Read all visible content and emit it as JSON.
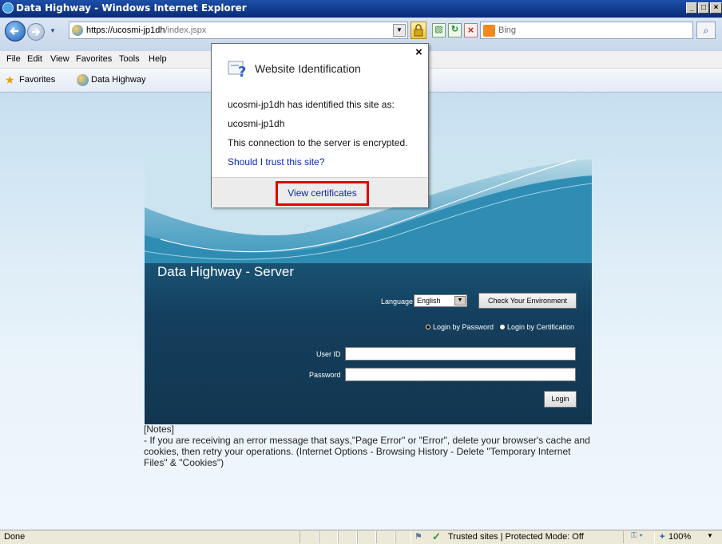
{
  "window": {
    "title": "Data Highway - Windows Internet Explorer"
  },
  "addressbar": {
    "url_host": "https://ucosmi-jp1dh",
    "url_path": "/index.jspx",
    "search_placeholder": "Bing"
  },
  "menu": {
    "items": [
      "File",
      "Edit",
      "View",
      "Favorites",
      "Tools",
      "Help"
    ]
  },
  "favorites": {
    "favorites_label": "Favorites",
    "tab_label": "Data Highway"
  },
  "login": {
    "title": "Data Highway - Server",
    "language_label": "Language",
    "language_value": "English",
    "check_env_button": "Check Your Environment",
    "radio_password": "Login by Password",
    "radio_certification": "Login by Certification",
    "userid_label": "User ID",
    "password_label": "Password",
    "login_button": "Login",
    "selected_radio": "password"
  },
  "notes": {
    "heading": "[Notes]",
    "body": "- If you are receiving an error message that says,\"Page Error\" or \"Error\", delete your browser's cache and cookies, then retry your operations. (Internet Options - Browsing History - Delete \"Temporary Internet Files\" & \"Cookies\")"
  },
  "popup": {
    "title": "Website Identification",
    "line1": "ucosmi-jp1dh has identified this site as:",
    "line2": "ucosmi-jp1dh",
    "line3": "This connection to the server is encrypted.",
    "link": "Should I trust this site?",
    "view_certificates": "View certificates",
    "close": "×"
  },
  "status": {
    "left": "Done",
    "zone": "Trusted sites | Protected Mode: Off",
    "zoom": "100%"
  },
  "colors": {
    "highlight": "#e00000",
    "link": "#0a2aa8",
    "panel": "#143f5e"
  }
}
